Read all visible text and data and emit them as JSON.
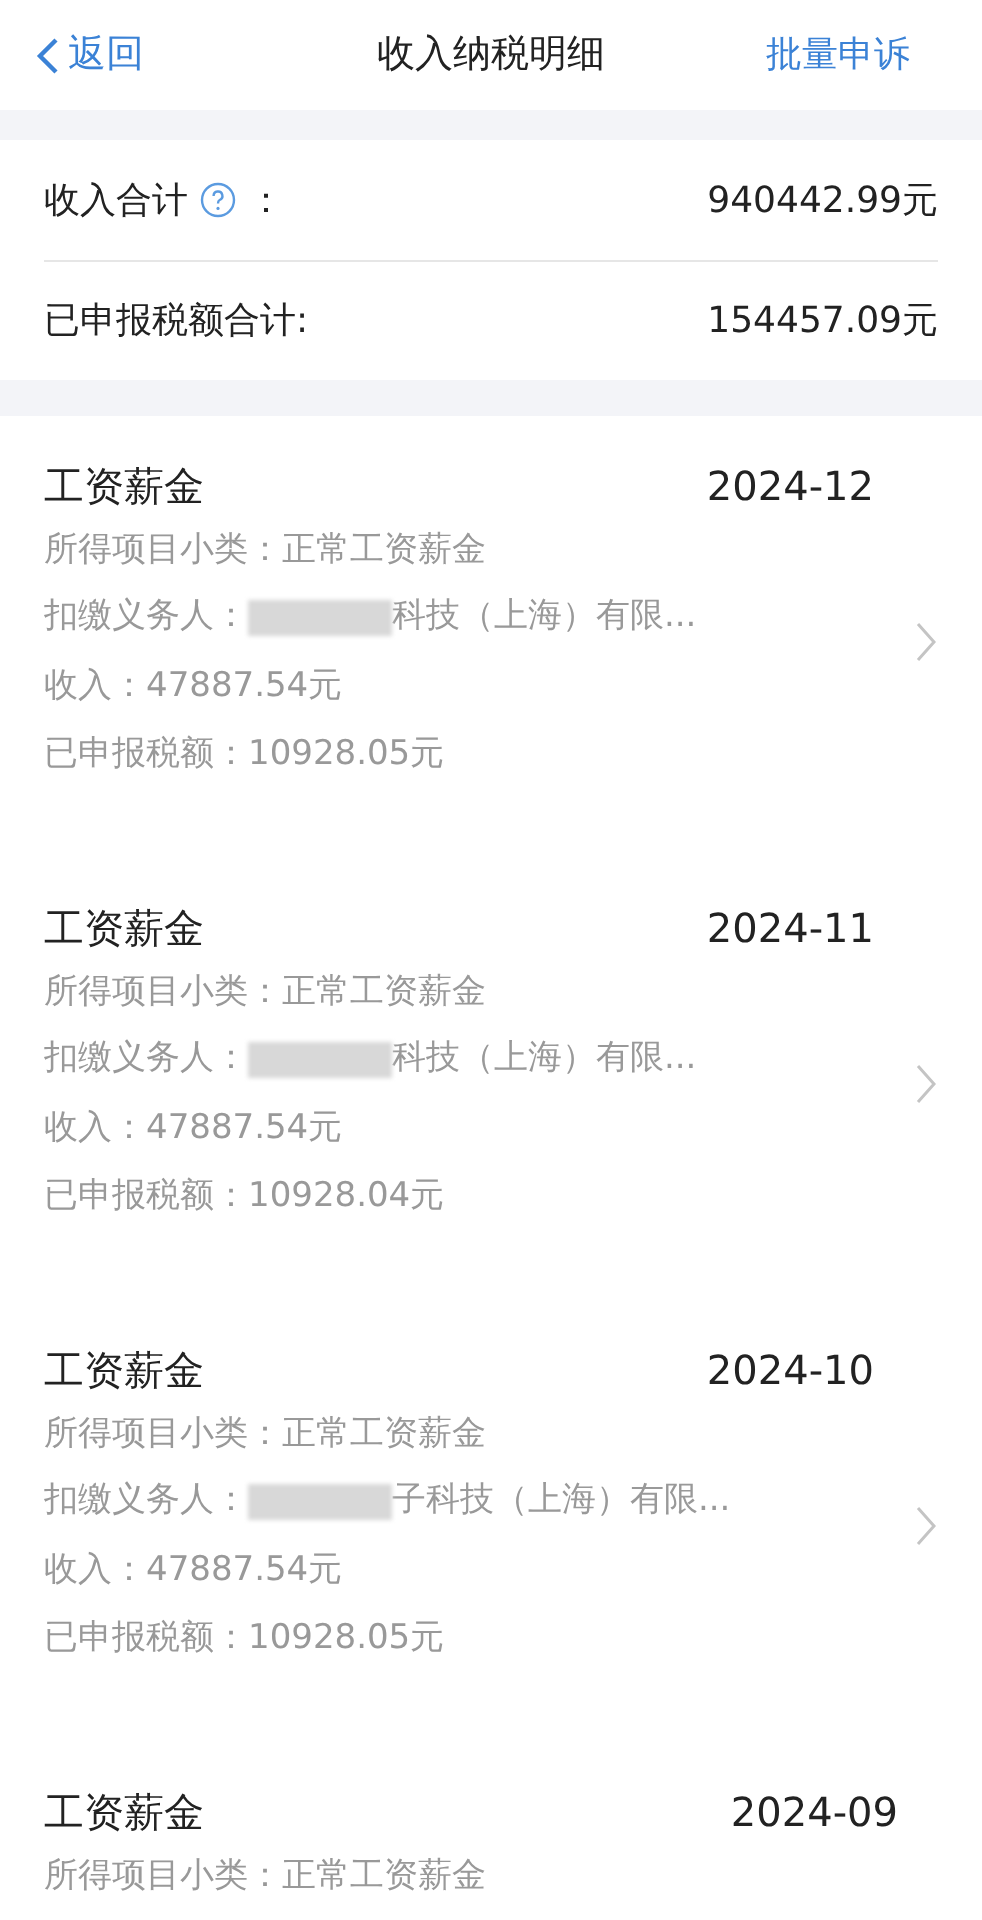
{
  "nav": {
    "back": "返回",
    "title": "收入纳税明细",
    "action": "批量申诉"
  },
  "summary": [
    {
      "label": "收入合计",
      "has_help": true,
      "colon": "：",
      "value": "940442.99元"
    },
    {
      "label": "已申报税额合计:",
      "has_help": false,
      "value": "154457.09元"
    }
  ],
  "records": [
    {
      "title": "工资薪金",
      "period": "2024-12",
      "subcategory": "所得项目小类：正常工资薪金",
      "withholder_label": "扣缴义务人：",
      "redacted": true,
      "withholder": "科技（上海）有限...",
      "income": "收入：47887.54元",
      "tax": "已申报税额：10928.05元"
    },
    {
      "title": "工资薪金",
      "period": "2024-11",
      "subcategory": "所得项目小类：正常工资薪金",
      "withholder_label": "扣缴义务人：",
      "redacted": true,
      "withholder": "科技（上海）有限...",
      "income": "收入：47887.54元",
      "tax": "已申报税额：10928.04元"
    },
    {
      "title": "工资薪金",
      "period": "2024-10",
      "subcategory": "所得项目小类：正常工资薪金",
      "withholder_label": "扣缴义务人：",
      "redacted": true,
      "withholder": "子科技（上海）有限...",
      "income": "收入：47887.54元",
      "tax": "已申报税额：10928.05元"
    },
    {
      "title": "工资薪金",
      "period": "2024-09",
      "subcategory": "所得项目小类：正常工资薪金"
    }
  ]
}
